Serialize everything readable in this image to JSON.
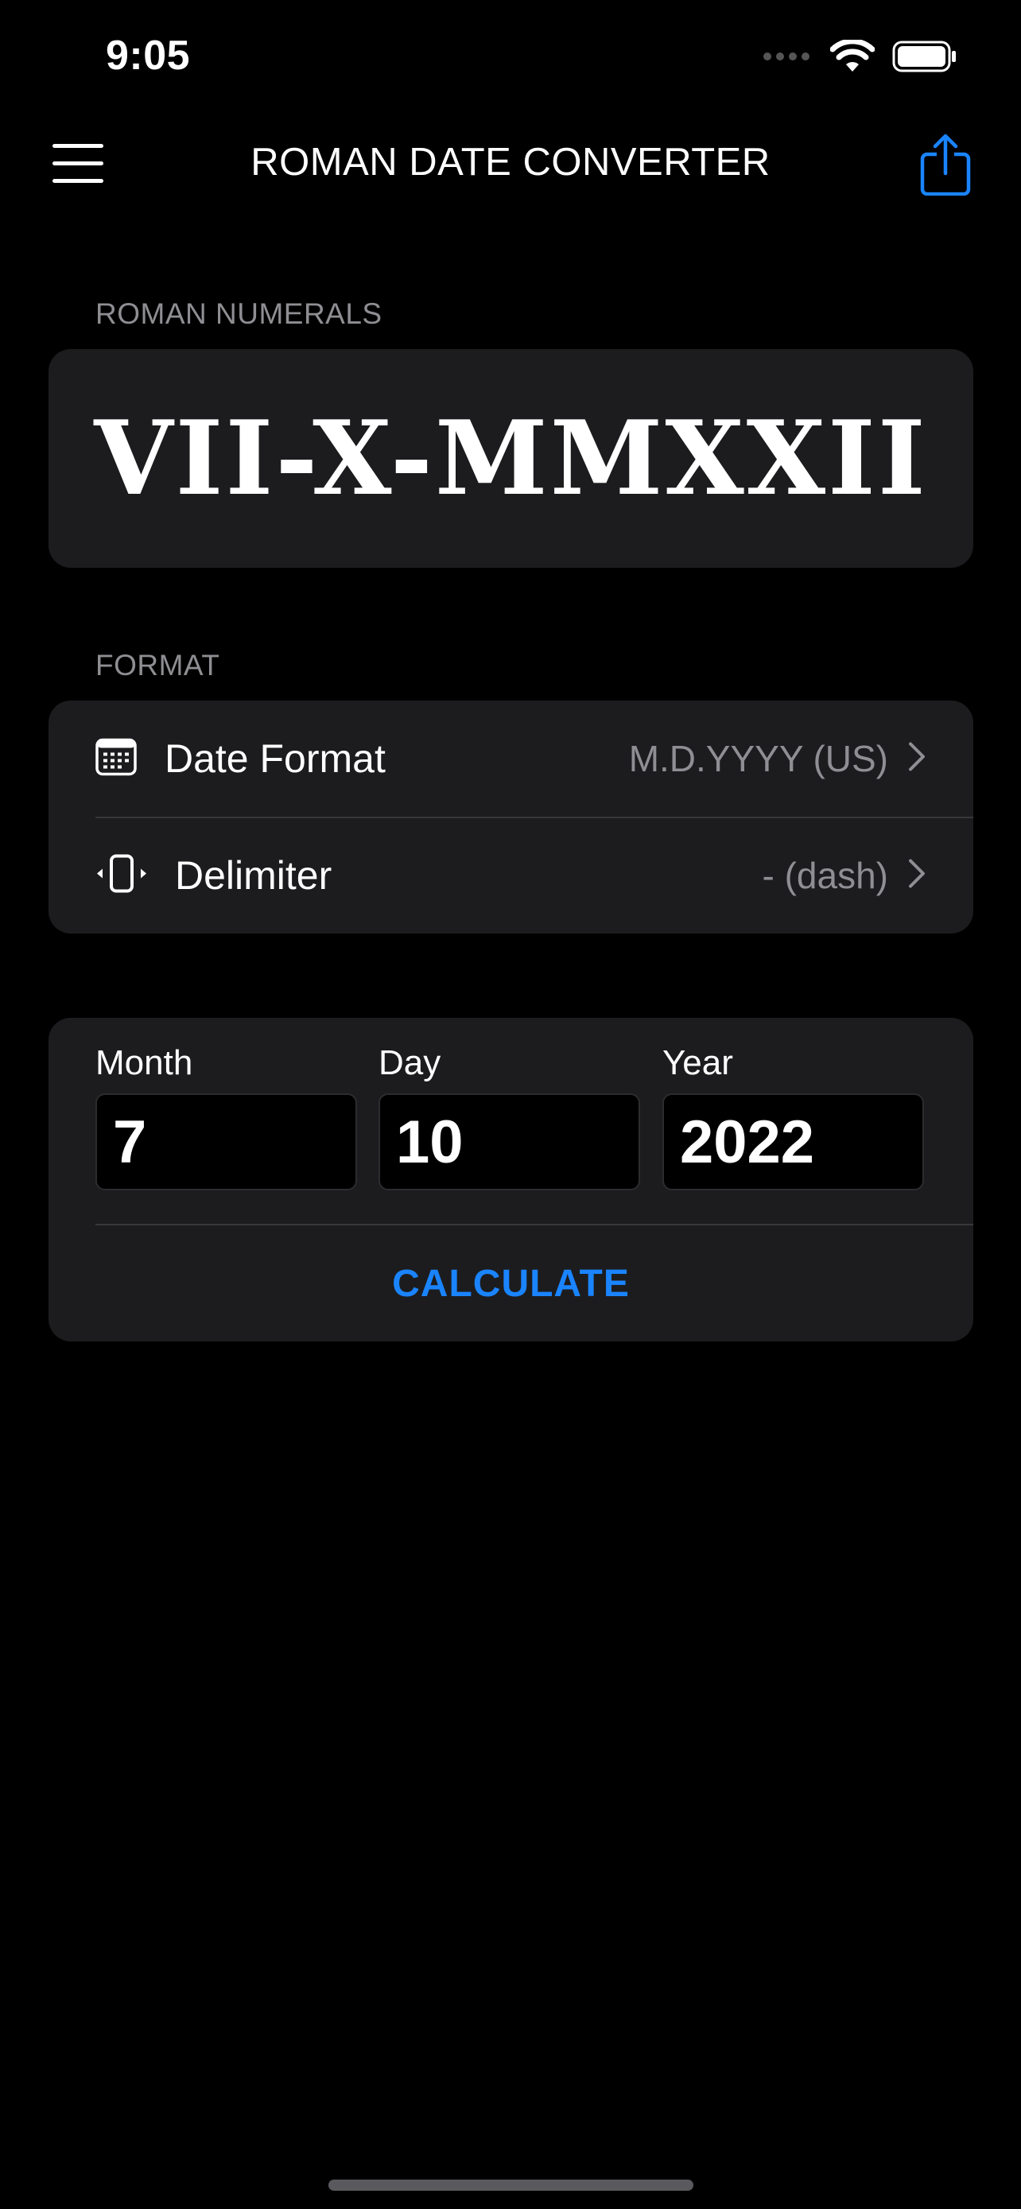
{
  "status_bar": {
    "time": "9:05"
  },
  "nav": {
    "title": "ROMAN DATE CONVERTER",
    "menu_icon": "hamburger-menu-icon",
    "share_icon": "share-icon",
    "accent_color": "#1a84ff"
  },
  "roman_section": {
    "label": "ROMAN NUMERALS",
    "value": "VII-X-MMXXII"
  },
  "format_section": {
    "label": "FORMAT",
    "rows": [
      {
        "icon": "calendar-icon",
        "label": "Date Format",
        "value": "M.D.YYYY (US)"
      },
      {
        "icon": "delimiter-icon",
        "label": "Delimiter",
        "value": "- (dash)"
      }
    ]
  },
  "date_inputs": {
    "month": {
      "label": "Month",
      "value": "7"
    },
    "day": {
      "label": "Day",
      "value": "10"
    },
    "year": {
      "label": "Year",
      "value": "2022"
    },
    "calculate_label": "CALCULATE"
  },
  "colors": {
    "background": "#000000",
    "card": "#1c1c1e",
    "secondary_text": "#8e8e93",
    "accent": "#1a84ff"
  }
}
